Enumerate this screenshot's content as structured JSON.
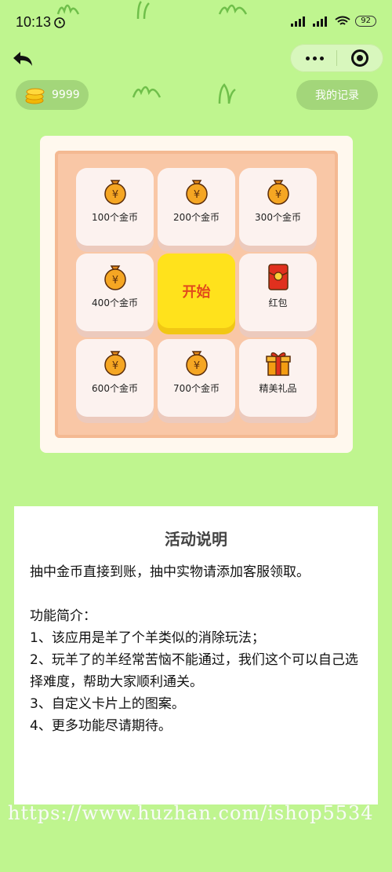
{
  "status_bar": {
    "time": "10:13",
    "battery": "92"
  },
  "nav": {
    "back_icon": "back-arrow-icon",
    "more_icon": "more-dots-icon",
    "target_icon": "target-icon"
  },
  "header": {
    "coins": "9999",
    "records_label": "我的记录"
  },
  "grid": {
    "cells": [
      {
        "label": "100个金币",
        "icon": "coin-bag-icon"
      },
      {
        "label": "200个金币",
        "icon": "coin-bag-icon"
      },
      {
        "label": "300个金币",
        "icon": "coin-bag-icon"
      },
      {
        "label": "400个金币",
        "icon": "coin-bag-icon"
      },
      {
        "label": "红包",
        "icon": "red-envelope-icon"
      },
      {
        "label": "600个金币",
        "icon": "coin-bag-icon"
      },
      {
        "label": "700个金币",
        "icon": "coin-bag-icon"
      },
      {
        "label": "精美礼品",
        "icon": "gift-icon"
      }
    ],
    "start_label": "开始"
  },
  "notice": {
    "title": "活动说明",
    "lines": [
      "抽中金币直接到账，抽中实物请添加客服领取。",
      "",
      "功能简介：",
      "1、该应用是羊了个羊类似的消除玩法；",
      "2、玩羊了的羊经常苦恼不能通过，我们这个可以自己选择难度，帮助大家顺利通关。",
      "3、自定义卡片上的图案。",
      "4、更多功能尽请期待。"
    ]
  },
  "watermark": "https://www.huzhan.com/ishop5534",
  "colors": {
    "background": "#bff58f",
    "start": "#ffe21c",
    "start_text": "#e24b1c"
  }
}
